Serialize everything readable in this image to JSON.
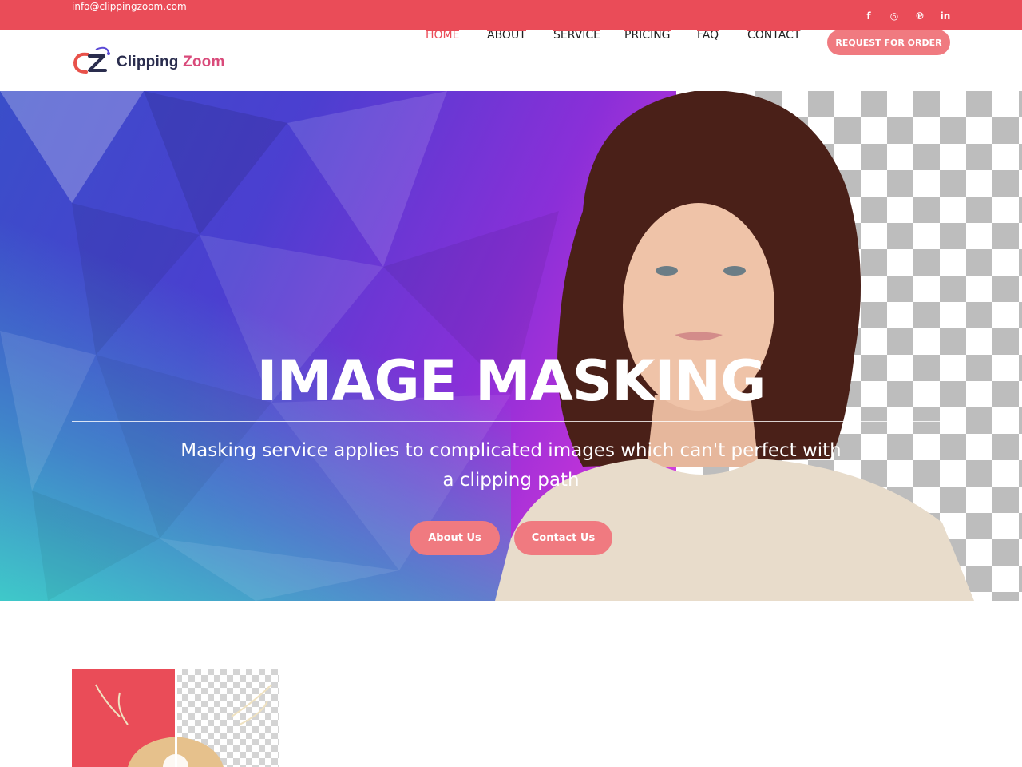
{
  "topbar": {
    "email": "info@clippingzoom.com",
    "social": [
      {
        "icon": "facebook-icon",
        "glyph": "f"
      },
      {
        "icon": "instagram-icon",
        "glyph": "◎"
      },
      {
        "icon": "pinterest-icon",
        "glyph": "℗"
      },
      {
        "icon": "linkedin-icon",
        "glyph": "in"
      }
    ]
  },
  "header": {
    "logo_main": "Clipping ",
    "logo_accent": "Zoom",
    "nav": [
      {
        "label": "HOME",
        "active": true
      },
      {
        "label": "ABOUT",
        "active": false
      },
      {
        "label": "SERVICE",
        "active": false
      },
      {
        "label": "PRICING",
        "active": false
      },
      {
        "label": "FAQ",
        "active": false
      },
      {
        "label": "CONTACT",
        "active": false
      }
    ],
    "order_button": "REQUEST FOR ORDER"
  },
  "hero": {
    "title": "IMAGE MASKING",
    "subtitle": "Masking service applies to complicated images which can't perfect with a clipping path",
    "buttons": [
      "About Us",
      "Contact Us"
    ]
  },
  "colors": {
    "accent": "#ea4c58",
    "button": "#f07a80"
  }
}
